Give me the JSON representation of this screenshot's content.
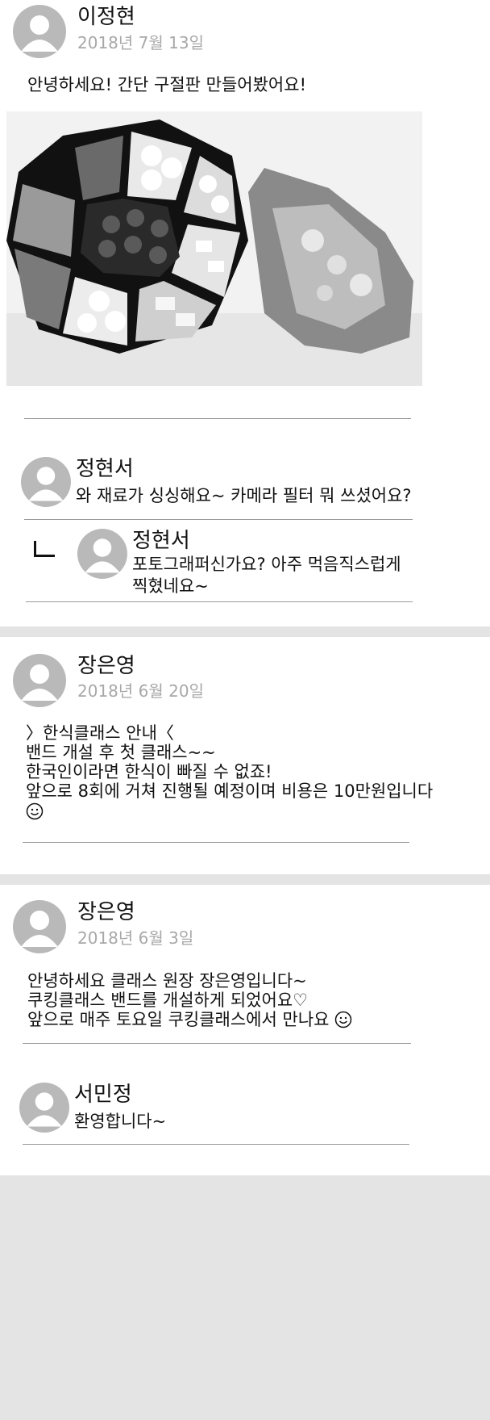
{
  "posts": [
    {
      "author": "이정현",
      "date": "2018년 7월 13일",
      "lines": [
        "안녕하세요! 간단 구절판 만들어봤어요!"
      ],
      "comments": [
        {
          "author": "정현서",
          "text": "와 재료가 싱싱해요~ 카메라 필터 뭐 쓰셨어요?"
        }
      ],
      "replies": [
        {
          "author": "정현서",
          "text": "포토그래퍼신가요? 아주 먹음직스럽게 찍혔네요~"
        }
      ]
    },
    {
      "author": "장은영",
      "date": "2018년 6월 20일",
      "lines": [
        "〉한식클래스 안내〈",
        "밴드 개설 후 첫 클래스~~",
        "한국인이라면 한식이 빠질 수 없죠!",
        "앞으로 8회에 거쳐 진행될 예정이며 비용은 10만원입니다"
      ]
    },
    {
      "author": "장은영",
      "date": "2018년 6월 3일",
      "lines": [
        "안녕하세요 클래스 원장 장은영입니다~",
        "쿠킹클래스 밴드를 개설하게 되었어요♡",
        "앞으로 매주 토요일 쿠킹클래스에서 만나요"
      ],
      "comments": [
        {
          "author": "서민정",
          "text": "환영합니다~"
        }
      ]
    }
  ],
  "icons": {
    "avatar": "user-silhouette-icon",
    "smile": "smiley-face-icon",
    "reply": "reply-arrow-icon"
  },
  "colors": {
    "avatar_bg": "#b9b9b9",
    "date": "#a8a8a8",
    "divider": "#9a9a9a",
    "band": "#e4e4e4"
  }
}
